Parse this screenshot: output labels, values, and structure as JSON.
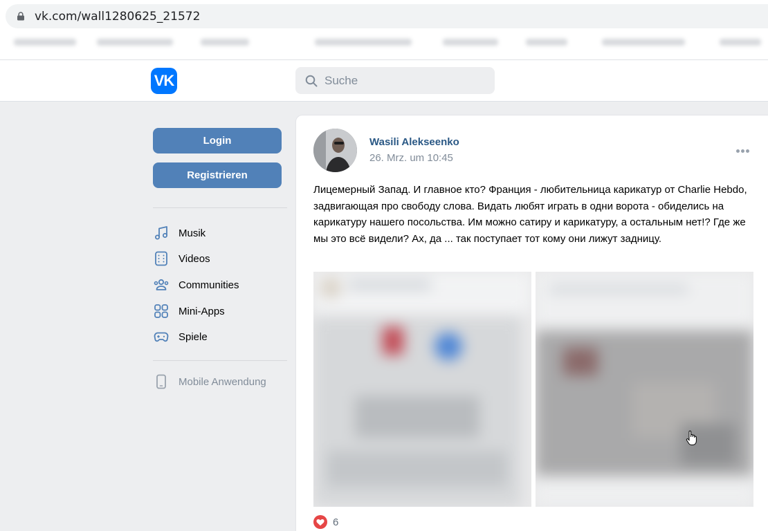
{
  "browser": {
    "url": "vk.com/wall1280625_21572"
  },
  "header": {
    "logo_text": "VK",
    "search_placeholder": "Suche"
  },
  "sidebar": {
    "login_label": "Login",
    "register_label": "Registrieren",
    "nav": [
      {
        "label": "Musik",
        "icon": "music-note-icon"
      },
      {
        "label": "Videos",
        "icon": "video-film-icon"
      },
      {
        "label": "Communities",
        "icon": "users-icon"
      },
      {
        "label": "Mini-Apps",
        "icon": "apps-grid-icon"
      },
      {
        "label": "Spiele",
        "icon": "gamepad-icon"
      }
    ],
    "mobile_label": "Mobile Anwendung"
  },
  "post": {
    "author": "Wasili Alekseenko",
    "date": "26. Mrz. um 10:45",
    "text": "Лицемерный Запад. И главное кто? Франция - любительница карикатур от Charlie Hebdo, задвигающая про свободу слова. Видать любят играть в одни ворота - обиделись на карикатуру нашего посольства. Им можно сатиру и карикатуру, а остальным нет!? Где же мы это всё видели? Ах, да ... так поступает тот кому они лижут задницу.",
    "likes": "6"
  },
  "colors": {
    "accent": "#5181b8",
    "vk_blue": "#0077ff",
    "link": "#2a5885",
    "like_red": "#e64646"
  }
}
